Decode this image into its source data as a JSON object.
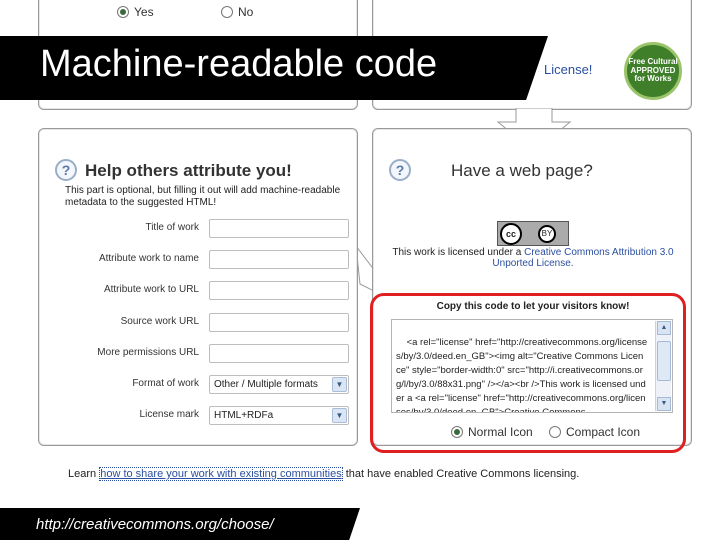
{
  "slide": {
    "title": "Machine-readable code",
    "url": "http://creativecommons.org/choose/"
  },
  "top_left_panel": {
    "radio_yes": "Yes",
    "radio_no": "No",
    "selected": "yes"
  },
  "top_right_panel": {
    "license_link": "License!",
    "badge_text": "Free Cultural APPROVED for Works"
  },
  "attribute_panel": {
    "help_icon": "?",
    "heading": "Help others attribute you!",
    "intro": "This part is optional, but filling it out will add machine-readable metadata to the suggested HTML!",
    "fields": [
      {
        "label": "Title of work",
        "value": ""
      },
      {
        "label": "Attribute work to name",
        "value": ""
      },
      {
        "label": "Attribute work to URL",
        "value": ""
      },
      {
        "label": "Source work URL",
        "value": ""
      },
      {
        "label": "More permissions URL",
        "value": ""
      }
    ],
    "format_label": "Format of work",
    "format_value": "Other / Multiple formats",
    "markup_label": "License mark",
    "markup_value": "HTML+RDFa"
  },
  "webpage_panel": {
    "help_icon": "?",
    "heading": "Have a web page?",
    "cc_logo": "cc",
    "by_logo": "BY",
    "license_text_prefix": "This work is licensed under a ",
    "license_link": "Creative Commons Attribution 3.0 Unported License.",
    "copy_heading": "Copy this code to let your visitors know!",
    "code": "<a rel=\"license\" href=\"http://creativecommons.org/licenses/by/3.0/deed.en_GB\"><img alt=\"Creative Commons Licence\" style=\"border-width:0\" src=\"http://i.creativecommons.org/l/by/3.0/88x31.png\" /></a><br />This work is licensed under a <a rel=\"license\" href=\"http://creativecommons.org/licenses/by/3.0/deed.en_GB\">Creative Commons",
    "radio_normal": "Normal Icon",
    "radio_compact": "Compact Icon",
    "selected_icon": "normal"
  },
  "footer": {
    "learn_prefix": "Learn ",
    "learn_link": "how to share your work with existing communities",
    "learn_suffix": " that have enabled Creative Commons licensing."
  },
  "colors": {
    "link": "#2a4fa0",
    "highlight_ring": "#e02020",
    "banner": "#000000"
  }
}
